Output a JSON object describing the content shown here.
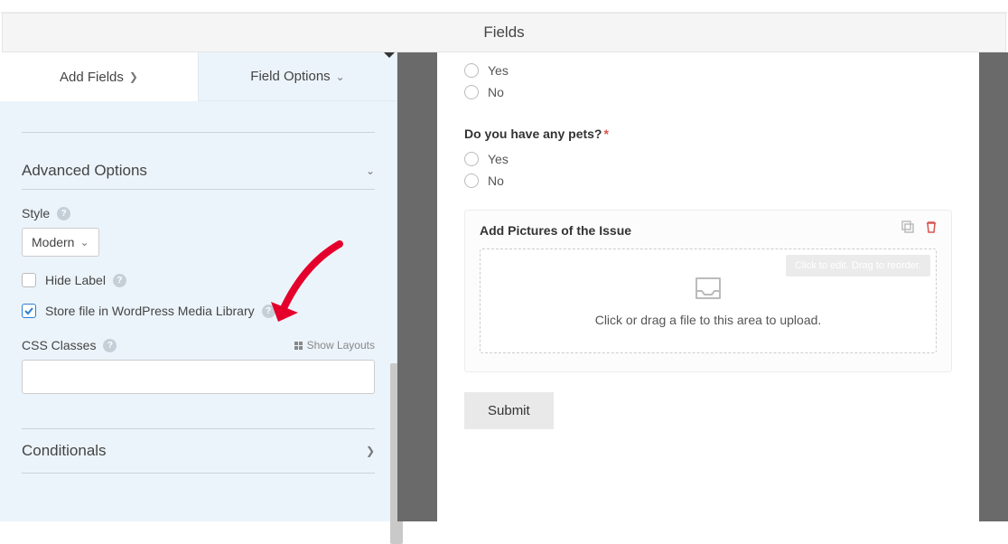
{
  "header": {
    "title": "Fields"
  },
  "tabs": {
    "add_fields": "Add Fields",
    "field_options": "Field Options"
  },
  "sidebar": {
    "advanced_options": "Advanced Options",
    "style_label": "Style",
    "style_value": "Modern",
    "hide_label": "Hide Label",
    "store_media": "Store file in WordPress Media Library",
    "css_classes": "CSS Classes",
    "show_layouts": "Show Layouts",
    "css_value": "",
    "conditionals": "Conditionals"
  },
  "form": {
    "radio1": {
      "options": [
        "Yes",
        "No"
      ]
    },
    "question2": "Do you have any pets?",
    "radio2": {
      "options": [
        "Yes",
        "No"
      ]
    },
    "upload_title": "Add Pictures of the Issue",
    "drop_text": "Click or drag a file to this area to upload.",
    "tooltip": "Click to edit. Drag to reorder.",
    "submit": "Submit"
  }
}
